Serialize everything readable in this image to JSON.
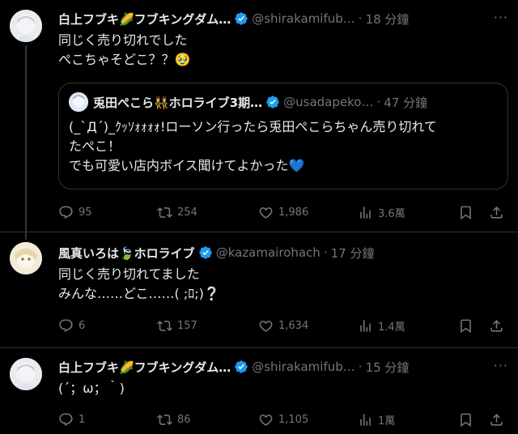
{
  "tweets": [
    {
      "name": "白上フブキ🌽フブキングダム…",
      "handle": "@shirakamifub…",
      "time": "18 分鐘",
      "text": [
        "同じく売り切れでした",
        "ぺこちゃそどこ？？🥹"
      ],
      "quote": {
        "name": "兎田ぺこら👯ホロライブ3期…",
        "handle": "@usadapeko…",
        "time": "47 分鐘",
        "text": [
          "(_`Д´)_ｸｯｿｫｫｫｫ!ローソン行ったら兎田ぺこらちゃん売り切れて",
          "たぺこ！",
          "でも可愛い店内ボイス聞けてよかった💙"
        ]
      },
      "stats": {
        "replies": "95",
        "retweets": "254",
        "likes": "1,986",
        "views": "3.6萬"
      }
    },
    {
      "name": "風真いろは🍃ホロライブ",
      "handle": "@kazamairohach",
      "time": "17 分鐘",
      "text": [
        "同じく売り切れてました",
        "みんな……どこ……( ;ﾛ;)❔"
      ],
      "stats": {
        "replies": "6",
        "retweets": "157",
        "likes": "1,634",
        "views": "1.4萬"
      }
    },
    {
      "name": "白上フブキ🌽フブキングダム…",
      "handle": "@shirakamifub…",
      "time": "15 分鐘",
      "text": [
        "(´；ω；｀)"
      ],
      "stats": {
        "replies": "1",
        "retweets": "86",
        "likes": "1,105",
        "views": "1萬"
      }
    }
  ],
  "icons": {
    "reply": "reply-icon",
    "retweet": "retweet-icon",
    "like": "heart-icon",
    "views": "views-icon",
    "bookmark": "bookmark-icon",
    "share": "share-icon",
    "more": "more-icon",
    "verified": "verified-badge-icon"
  },
  "colors": {
    "background": "#000000",
    "text": "#e7e9ea",
    "muted": "#71767b",
    "verified": "#1d9bf0",
    "border": "#2f3336"
  }
}
